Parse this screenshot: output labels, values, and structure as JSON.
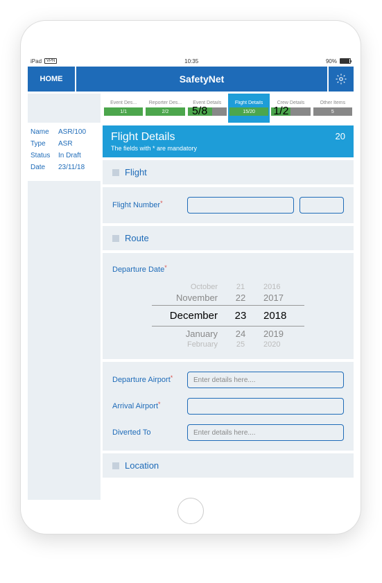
{
  "status": {
    "device": "iPad",
    "vpn": "VPN",
    "time": "10:35",
    "battery": "90%"
  },
  "nav": {
    "home": "HOME",
    "title": "SafetyNet"
  },
  "tabs": [
    {
      "label": "Event Des...",
      "count": "1/1",
      "style": "green"
    },
    {
      "label": "Reporter Des...",
      "count": "2/2",
      "style": "green"
    },
    {
      "label": "Event Details",
      "count": "5/8",
      "style": "split",
      "green": 62
    },
    {
      "label": "Flight Details",
      "count": "15/20",
      "style": "green",
      "active": true
    },
    {
      "label": "Crew Details",
      "count": "1/2",
      "style": "split",
      "green": 50
    },
    {
      "label": "Other Items",
      "count": "5",
      "style": "grey"
    }
  ],
  "meta": {
    "name_label": "Name",
    "name": "ASR/100",
    "type_label": "Type",
    "type": "ASR",
    "status_label": "Status",
    "status": "In Draft",
    "date_label": "Date",
    "date": "23/11/18"
  },
  "header": {
    "title": "Flight Details",
    "sub": "The fields with * are mandatory",
    "count": "20"
  },
  "sections": {
    "flight": "Flight",
    "route": "Route",
    "location": "Location"
  },
  "fields": {
    "flight_number": "Flight Number",
    "departure_date": "Departure Date",
    "departure_airport": "Departure Airport",
    "arrival_airport": "Arrival Airport",
    "diverted_to": "Diverted To",
    "placeholder": "Enter details here...."
  },
  "picker": {
    "rows": [
      {
        "m": "October",
        "d": "21",
        "y": "2016",
        "cls": ""
      },
      {
        "m": "November",
        "d": "22",
        "y": "2017",
        "cls": "near"
      },
      {
        "m": "December",
        "d": "23",
        "y": "2018",
        "cls": "selected"
      },
      {
        "m": "January",
        "d": "24",
        "y": "2019",
        "cls": "near"
      },
      {
        "m": "February",
        "d": "25",
        "y": "2020",
        "cls": ""
      }
    ]
  }
}
